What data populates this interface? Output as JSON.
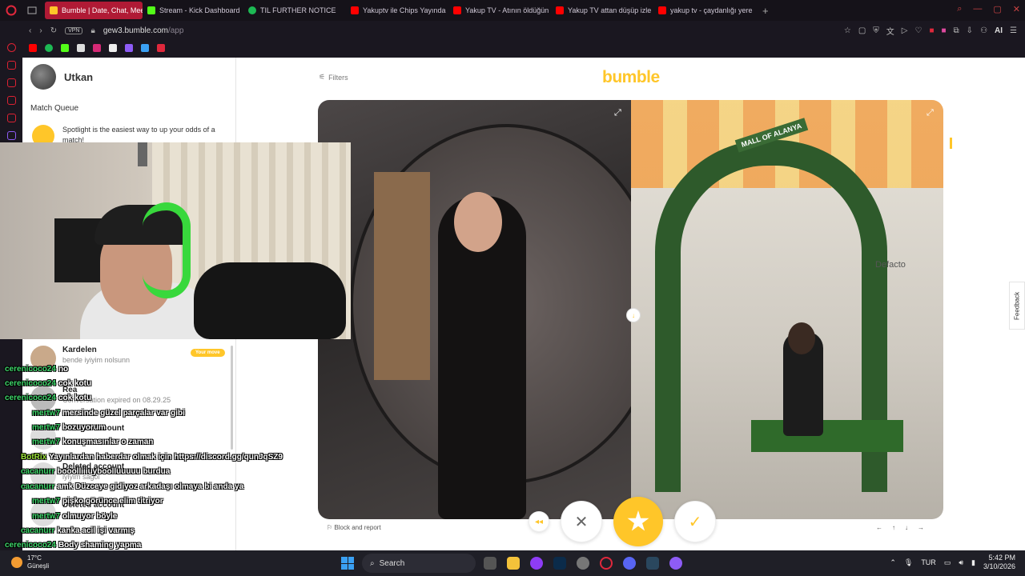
{
  "browser": {
    "tabs": [
      {
        "label": "Bumble | Date, Chat, Meet",
        "color": "#ffc629",
        "active": true
      },
      {
        "label": "Stream - Kick Dashboard",
        "color": "#53fc18",
        "active": false
      },
      {
        "label": "TIL FURTHER NOTICE",
        "color": "#1db954",
        "active": false
      },
      {
        "label": "Yakuptv ile Chips Yayında",
        "color": "#ff0000",
        "active": false
      },
      {
        "label": "Yakup TV - Atının öldüğün",
        "color": "#ff0000",
        "active": false
      },
      {
        "label": "Yakup TV attan düşüp izle",
        "color": "#ff0000",
        "active": false
      },
      {
        "label": "yakup tv - çaydanlığı yere",
        "color": "#ff0000",
        "active": false
      }
    ],
    "vpn_label": "VPN",
    "url_host": "gew3.bumble.com",
    "url_path": "/app",
    "ai_label": "AI"
  },
  "bumble": {
    "user_name": "Utkan",
    "match_queue_title": "Match Queue",
    "spotlight_text": "Spotlight is the easiest way to up your odds of a match!",
    "matches": [
      {
        "name": "Kardelen",
        "sub": "bende iyiyim nolsunn"
      },
      {
        "name": "Rea",
        "sub": "Conversation expired on 08.29.25"
      },
      {
        "name": "Deleted account",
        "sub": ""
      },
      {
        "name": "Deleted account",
        "sub": "iyiyim sagol"
      },
      {
        "name": "Deleted account",
        "sub": ""
      }
    ],
    "your_move_label": "Your move",
    "filters_label": "Filters",
    "brand": "bumble",
    "mall_sign": "MALL OF ALANYA",
    "store_sign": "Defacto",
    "block_report": "Block and report",
    "feedback_label": "Feedback",
    "accent_color": "#ffc629"
  },
  "chat": [
    {
      "nick": "cerenicoco24",
      "msg": "no"
    },
    {
      "nick": "cerenicoco24",
      "msg": "cok kotu"
    },
    {
      "nick": "cerenicoco24",
      "msg": "cok kotu"
    },
    {
      "nick": "mertw7",
      "msg": "mersinde güzel parçalar var gibi"
    },
    {
      "nick": "mertw7",
      "msg": "bozuyorum"
    },
    {
      "nick": "mertw7",
      "msg": "konuşmasınlar o zaman"
    },
    {
      "nick": "BotRix",
      "msg": "Yayınlardan haberdar olmak için https://discord.gg/qunJqSZ9"
    },
    {
      "nick": "cacanurr",
      "msg": "booolliiiuyboolluuuuu burdua"
    },
    {
      "nick": "cacanurr",
      "msg": "amk Düzceye gidiyoz arkadaşı olmaya bi anda ya"
    },
    {
      "nick": "mertw7",
      "msg": "pişko görünce elim titriyor"
    },
    {
      "nick": "mertw7",
      "msg": "olmuyor böyle"
    },
    {
      "nick": "cacanurr",
      "msg": "kanka acil işi varmış"
    },
    {
      "nick": "cerenicoco24",
      "msg": "Body shaming yapma"
    }
  ],
  "taskbar": {
    "temperature": "17°C",
    "weather": "Güneşli",
    "search_label": "Search",
    "language": "TUR",
    "time": "5:42 PM",
    "date": "3/10/2026"
  }
}
